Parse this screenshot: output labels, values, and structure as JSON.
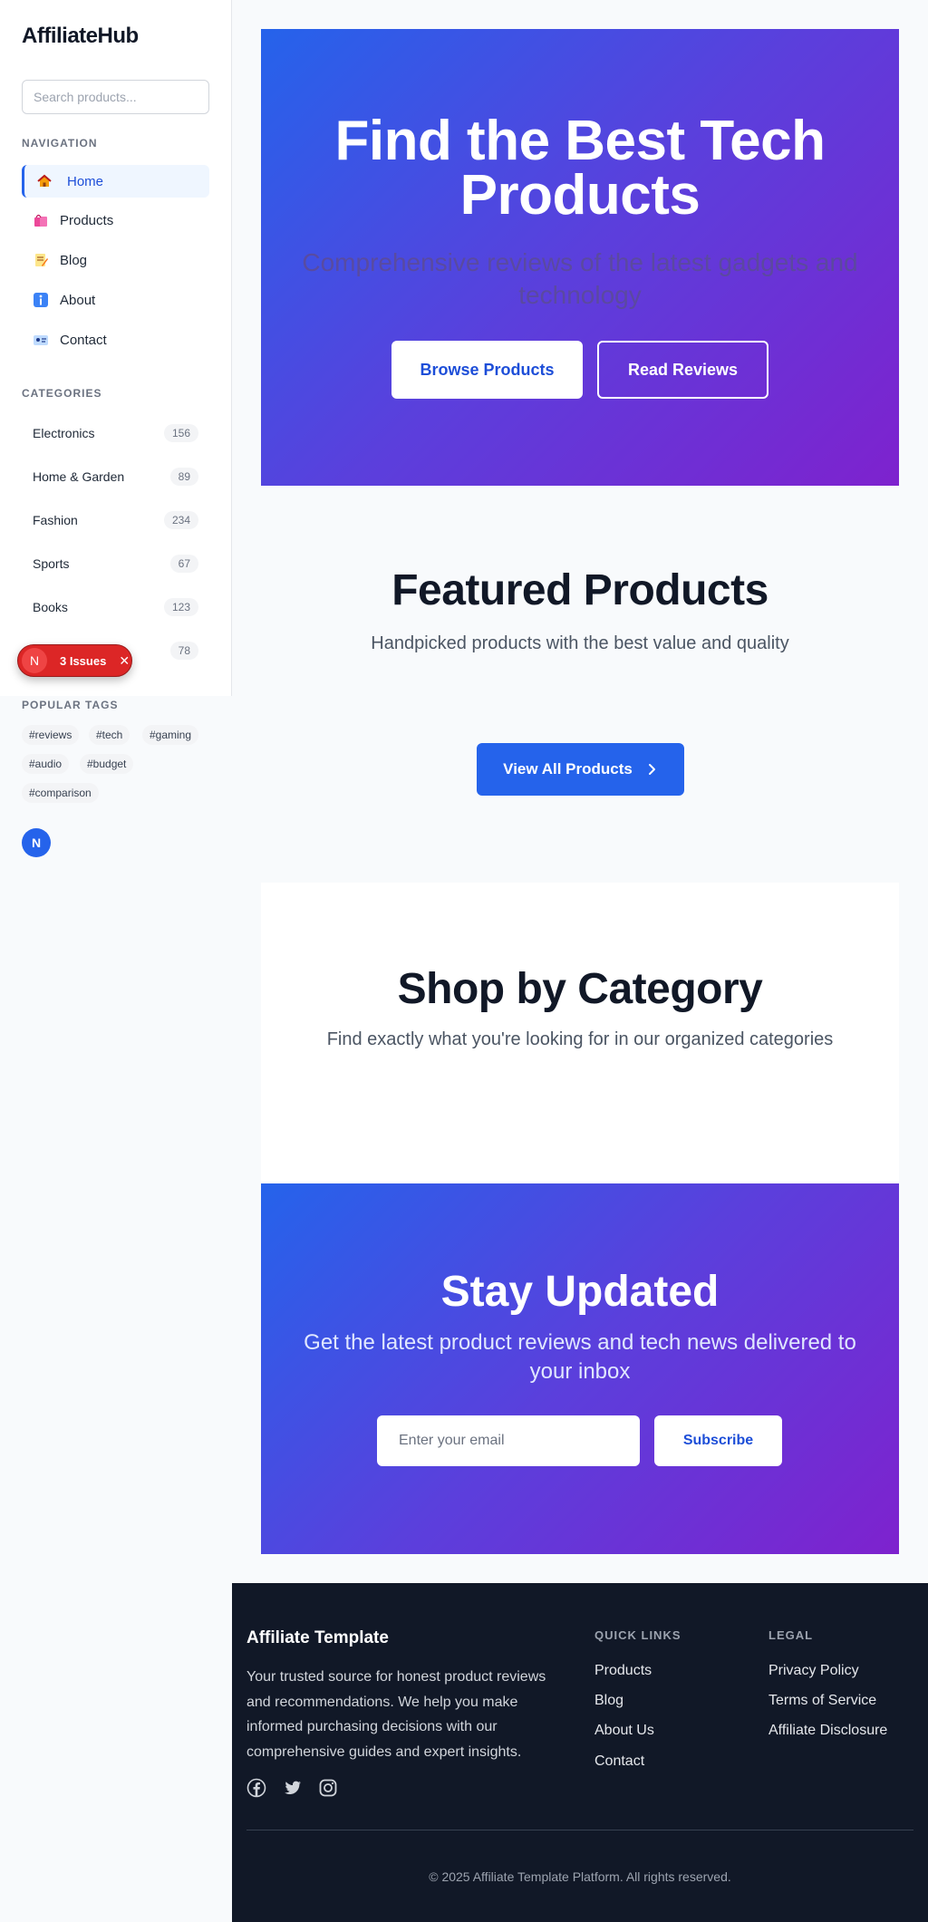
{
  "sidebar": {
    "logo": "AffiliateHub",
    "search_placeholder": "Search products...",
    "nav_heading": "NAVIGATION",
    "nav": [
      {
        "label": "Home",
        "icon": "house-icon",
        "active": true
      },
      {
        "label": "Products",
        "icon": "shopping-bags-icon",
        "active": false
      },
      {
        "label": "Blog",
        "icon": "memo-icon",
        "active": false
      },
      {
        "label": "About",
        "icon": "info-icon",
        "active": false
      },
      {
        "label": "Contact",
        "icon": "id-card-icon",
        "active": false
      }
    ],
    "categories_heading": "CATEGORIES",
    "categories": [
      {
        "label": "Electronics",
        "count": "156"
      },
      {
        "label": "Home & Garden",
        "count": "89"
      },
      {
        "label": "Fashion",
        "count": "234"
      },
      {
        "label": "Sports",
        "count": "67"
      },
      {
        "label": "Books",
        "count": "123"
      },
      {
        "label": "",
        "count": "78"
      }
    ],
    "tags_heading": "POPULAR TAGS",
    "tags": [
      "#reviews",
      "#tech",
      "#gaming",
      "#audio",
      "#budget",
      "#comparison"
    ],
    "avatar_initial": "N"
  },
  "issues_badge": {
    "logo": "N",
    "label": "3 Issues",
    "close": "✕"
  },
  "hero": {
    "title": "Find the Best Tech Products",
    "subtitle": "Comprehensive reviews of the latest gadgets and technology",
    "primary_button": "Browse Products",
    "secondary_button": "Read Reviews"
  },
  "featured": {
    "title": "Featured Products",
    "subtitle": "Handpicked products with the best value and quality",
    "button": "View All Products"
  },
  "shop_by_category": {
    "title": "Shop by Category",
    "subtitle": "Find exactly what you're looking for in our organized categories"
  },
  "newsletter": {
    "title": "Stay Updated",
    "subtitle": "Get the latest product reviews and tech news delivered to your inbox",
    "email_placeholder": "Enter your email",
    "button": "Subscribe"
  },
  "footer": {
    "brand": "Affiliate Template",
    "description": "Your trusted source for honest product reviews and recommendations. We help you make informed purchasing decisions with our comprehensive guides and expert insights.",
    "social_icons": [
      "facebook-icon",
      "twitter-icon",
      "instagram-icon"
    ],
    "quick_links_heading": "QUICK LINKS",
    "quick_links": [
      "Products",
      "Blog",
      "About Us",
      "Contact"
    ],
    "legal_heading": "LEGAL",
    "legal_links": [
      "Privacy Policy",
      "Terms of Service",
      "Affiliate Disclosure"
    ],
    "copyright": "© 2025 Affiliate Template Platform. All rights reserved."
  },
  "colors": {
    "primary": "#2563eb",
    "gradient_start": "#2563eb",
    "gradient_end": "#7e22ce",
    "footer_bg": "#111827",
    "issues_red": "#dc2626"
  }
}
